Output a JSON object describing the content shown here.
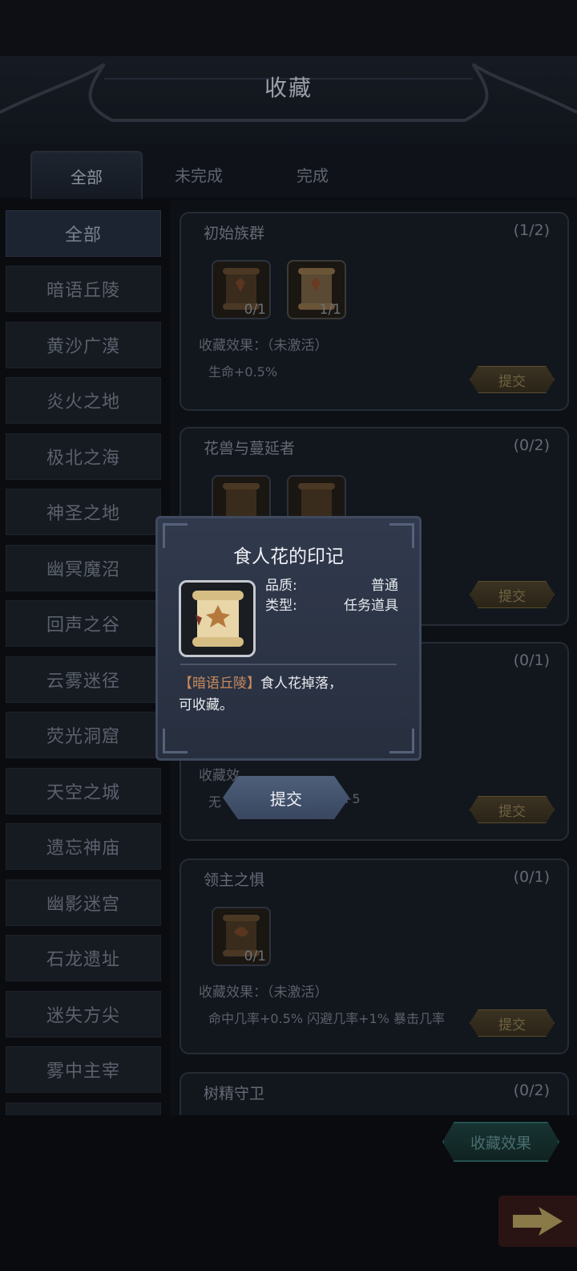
{
  "header": {
    "title": "收藏"
  },
  "tabs": [
    {
      "label": "全部",
      "active": true
    },
    {
      "label": "未完成",
      "active": false
    },
    {
      "label": "完成",
      "active": false
    }
  ],
  "sidebar": {
    "items": [
      {
        "label": "全部",
        "active": true
      },
      {
        "label": "暗语丘陵"
      },
      {
        "label": "黄沙广漠"
      },
      {
        "label": "炎火之地"
      },
      {
        "label": "极北之海"
      },
      {
        "label": "神圣之地"
      },
      {
        "label": "幽冥魔沼"
      },
      {
        "label": "回声之谷"
      },
      {
        "label": "云雾迷径"
      },
      {
        "label": "荧光洞窟"
      },
      {
        "label": "天空之城"
      },
      {
        "label": "遗忘神庙"
      },
      {
        "label": "幽影迷宫"
      },
      {
        "label": "石龙遗址"
      },
      {
        "label": "迷失方尖"
      },
      {
        "label": "雾中主宰"
      }
    ]
  },
  "collections": [
    {
      "name": "初始族群",
      "count": "(1/2)",
      "slots": [
        "0/1",
        "1/1"
      ],
      "effect_label": "收藏效果：（未激活）",
      "effect_text": "生命+0.5%",
      "submit_label": "提交"
    },
    {
      "name": "花兽与蔓延者",
      "count": "(0/2)",
      "submit_label": "提交"
    },
    {
      "count": "(0/1)",
      "effect_label_partial": "收藏效",
      "effect_text_partial_left": "无",
      "effect_text_partial_right": "+5",
      "submit_label": "提交"
    },
    {
      "name": "领主之惧",
      "count": "(0/1)",
      "slots": [
        "0/1"
      ],
      "effect_label": "收藏效果：（未激活）",
      "effect_text": "命中几率+0.5% 闪避几率+1% 暴击几率",
      "submit_label": "提交"
    },
    {
      "name": "树精守卫",
      "count": "(0/2)"
    }
  ],
  "footer": {
    "effects_button": "收藏效果"
  },
  "popup": {
    "title": "食人花的印记",
    "quality_label": "品质:",
    "quality_value": "普通",
    "type_label": "类型:",
    "type_value": "任务道具",
    "desc_highlight": "【暗语丘陵】",
    "desc_text": "食人花掉落，可收藏。",
    "submit_label": "提交"
  },
  "colors": {
    "accent_gold": "#6f6141",
    "highlight_orange": "#c98a5d",
    "popup_bg": "#2c3446"
  }
}
